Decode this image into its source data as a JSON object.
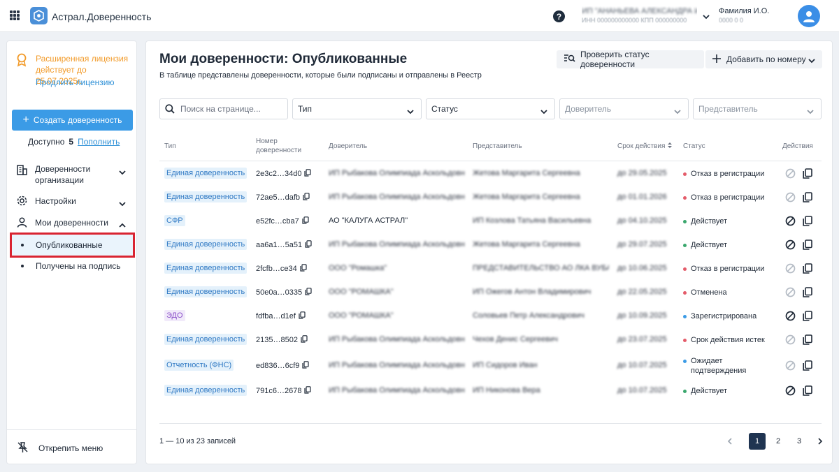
{
  "header": {
    "app_title": "Астрал.Доверенность",
    "org_line1": "ИП \"АНАНЬЕВА АЛЕКСАНДРА ИГОРЕВНА ЦЕНТР\"",
    "org_line2": "ИНН 000000000000 КПП 000000000",
    "user_line1": "Фамилия И.О.",
    "user_line2": "0000 0 0"
  },
  "sidebar": {
    "license_text": "Расширенная лицензия действует до 25.07.2025г.",
    "license_link": "Продлить лицензию",
    "create_button": "Создать доверенность",
    "available_label": "Доступно",
    "available_count": "5",
    "topup_link": "Пополнить",
    "nav": [
      {
        "label": "Доверенности организации"
      },
      {
        "label": "Настройки"
      },
      {
        "label": "Мои доверенности"
      }
    ],
    "sub_items": [
      {
        "label": "Опубликованные"
      },
      {
        "label": "Получены на подпись"
      }
    ],
    "unpin_label": "Открепить меню"
  },
  "main": {
    "title": "Мои доверенности: Опубликованные",
    "description": "В таблице представлены доверенности, которые были подписаны и отправлены в Реестр",
    "check_status_button": "Проверить статус доверенности",
    "add_by_number_button": "Добавить по номеру"
  },
  "filters": {
    "search_placeholder": "Поиск на странице...",
    "type": "Тип",
    "status": "Статус",
    "principal": "Доверитель",
    "representative": "Представитель"
  },
  "table": {
    "headers": {
      "type": "Тип",
      "number": "Номер доверенности",
      "principal": "Доверитель",
      "representative": "Представитель",
      "validity": "Срок действия",
      "status": "Статус",
      "actions": "Действия"
    },
    "rows": [
      {
        "type": "Единая доверенность",
        "type_style": "blue",
        "number": "2e3c2…34d0",
        "principal": "ИП Рыбакова Олимпиада Аскольдовна",
        "principal_blur": true,
        "representative": "Жетова Маргарита Сергеевна",
        "validity": "до 29.05.2025",
        "status": "Отказ в регистрации",
        "status_color": "#e45c6a",
        "revoke_active": false
      },
      {
        "type": "Единая доверенность",
        "type_style": "blue",
        "number": "72ae5…dafb",
        "principal": "ИП Рыбакова Олимпиада Аскольдовна",
        "principal_blur": true,
        "representative": "Жетова Маргарита Сергеевна",
        "validity": "до 01.01.2026",
        "status": "Отказ в регистрации",
        "status_color": "#e45c6a",
        "revoke_active": false
      },
      {
        "type": "СФР",
        "type_style": "blue",
        "number": "e52fc…cba7",
        "principal": "АО \"КАЛУГА АСТРАЛ\"",
        "principal_blur": false,
        "representative": "ИП Козлова Татьяна Васильевна",
        "validity": "до 04.10.2025",
        "status": "Действует",
        "status_color": "#3aa76d",
        "revoke_active": true
      },
      {
        "type": "Единая доверенность",
        "type_style": "blue",
        "number": "aa6a1…5a51",
        "principal": "ИП Рыбакова Олимпиада Аскольдовна",
        "principal_blur": true,
        "representative": "Жетова Маргарита Сергеевна",
        "validity": "до 29.07.2025",
        "status": "Действует",
        "status_color": "#3aa76d",
        "revoke_active": true
      },
      {
        "type": "Единая доверенность",
        "type_style": "blue",
        "number": "2fcfb…ce34",
        "principal": "ООО \"Ромашка\"",
        "principal_blur": true,
        "representative": "ПРЕДСТАВИТЕЛЬСТВО АО ЛКА ВУБА",
        "validity": "до 10.06.2025",
        "status": "Отказ в регистрации",
        "status_color": "#e45c6a",
        "revoke_active": false
      },
      {
        "type": "Единая доверенность",
        "type_style": "blue",
        "number": "50e0a…0335",
        "principal": "ООО \"РОМАШКА\"",
        "principal_blur": true,
        "representative": "ИП Ожегов Антон Владимирович",
        "validity": "до 22.05.2025",
        "status": "Отменена",
        "status_color": "#e45c6a",
        "revoke_active": false
      },
      {
        "type": "ЭДО",
        "type_style": "purple",
        "number": "fdfba…d1ef",
        "principal": "ООО \"РОМАШКА\"",
        "principal_blur": true,
        "representative": "Соловьев Петр Александрович",
        "validity": "до 10.09.2025",
        "status": "Зарегистрирована",
        "status_color": "#3b9be6",
        "revoke_active": true
      },
      {
        "type": "Единая доверенность",
        "type_style": "blue",
        "number": "2135…8502",
        "principal": "ИП Рыбакова Олимпиада Аскольдовна",
        "principal_blur": true,
        "representative": "Чехов Денис Сергеевич",
        "validity": "до 23.07.2025",
        "status": "Срок действия истек",
        "status_color": "#e45c6a",
        "revoke_active": false
      },
      {
        "type": "Отчетность (ФНС)",
        "type_style": "blue",
        "number": "ed836…6cf9",
        "principal": "ИП Рыбакова Олимпиада Аскольдовна",
        "principal_blur": true,
        "representative": "ИП Сидоров Иван",
        "validity": "до 10.07.2025",
        "status": "Ожидает подтверждения",
        "status_color": "#3b9be6",
        "revoke_active": false
      },
      {
        "type": "Единая доверенность",
        "type_style": "blue",
        "number": "791c6…2678",
        "principal": "ИП Рыбакова Олимпиада Аскольдовна",
        "principal_blur": true,
        "representative": "ИП Никонова Вера",
        "validity": "до 10.07.2025",
        "status": "Действует",
        "status_color": "#3aa76d",
        "revoke_active": true
      }
    ]
  },
  "footer": {
    "range": "1 — 10 из 23 записей",
    "pages": [
      "1",
      "2",
      "3"
    ],
    "current_page": "1"
  },
  "colors": {
    "accent": "#3b9be6",
    "license": "#f29b2a",
    "highlight": "#d92431",
    "status_ok": "#3aa76d",
    "status_error": "#e45c6a",
    "status_info": "#3b9be6"
  }
}
